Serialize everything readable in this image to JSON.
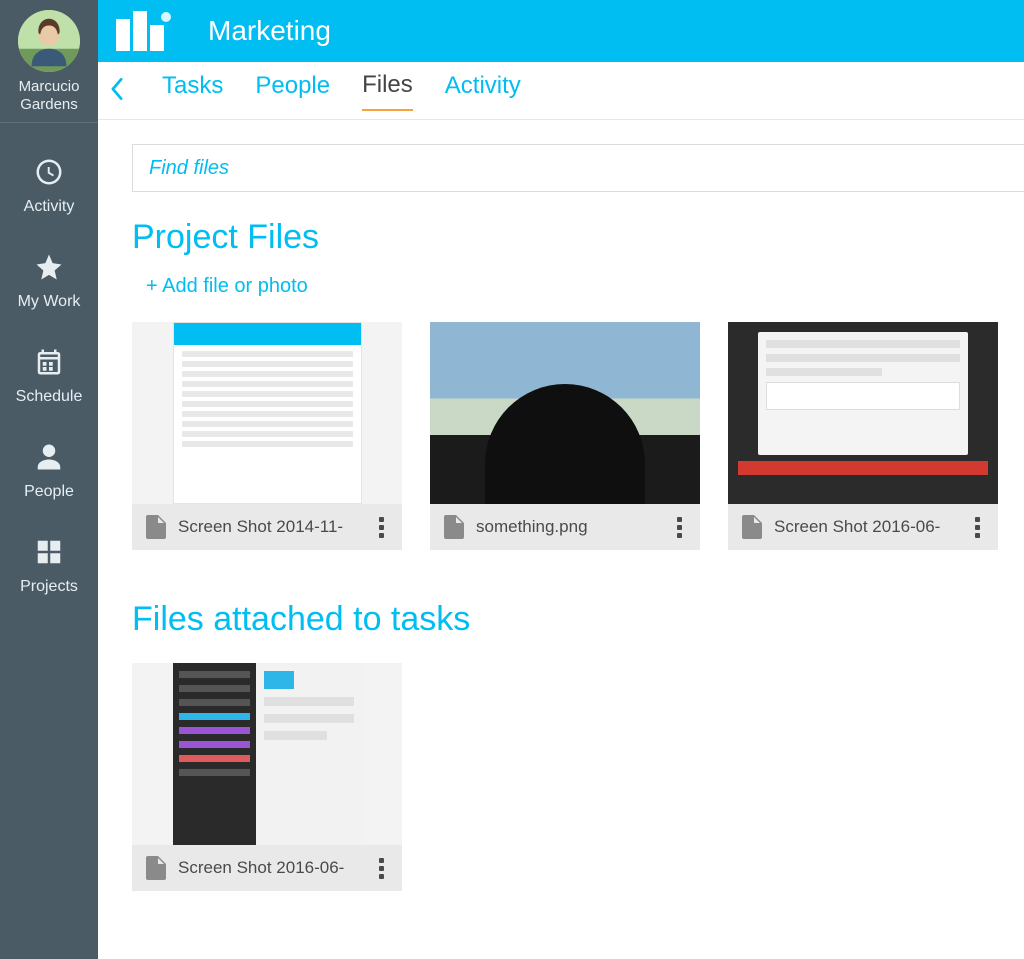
{
  "user": {
    "name": "Marcucio Gardens"
  },
  "sidebar": {
    "items": [
      {
        "label": "Activity"
      },
      {
        "label": "My Work"
      },
      {
        "label": "Schedule"
      },
      {
        "label": "People"
      },
      {
        "label": "Projects"
      }
    ]
  },
  "header": {
    "title": "Marketing"
  },
  "tabs": {
    "items": [
      {
        "label": "Tasks",
        "active": false
      },
      {
        "label": "People",
        "active": false
      },
      {
        "label": "Files",
        "active": true
      },
      {
        "label": "Activity",
        "active": false
      }
    ]
  },
  "search": {
    "placeholder": "Find files"
  },
  "sections": {
    "project_files": {
      "title": "Project Files",
      "add_file_label": "+ Add file or photo",
      "files": [
        {
          "name": "Screen Shot 2014-11-"
        },
        {
          "name": "something.png"
        },
        {
          "name": "Screen Shot 2016-06-"
        }
      ]
    },
    "task_files": {
      "title": "Files attached to tasks",
      "files": [
        {
          "name": "Screen Shot 2016-06-"
        }
      ]
    }
  }
}
